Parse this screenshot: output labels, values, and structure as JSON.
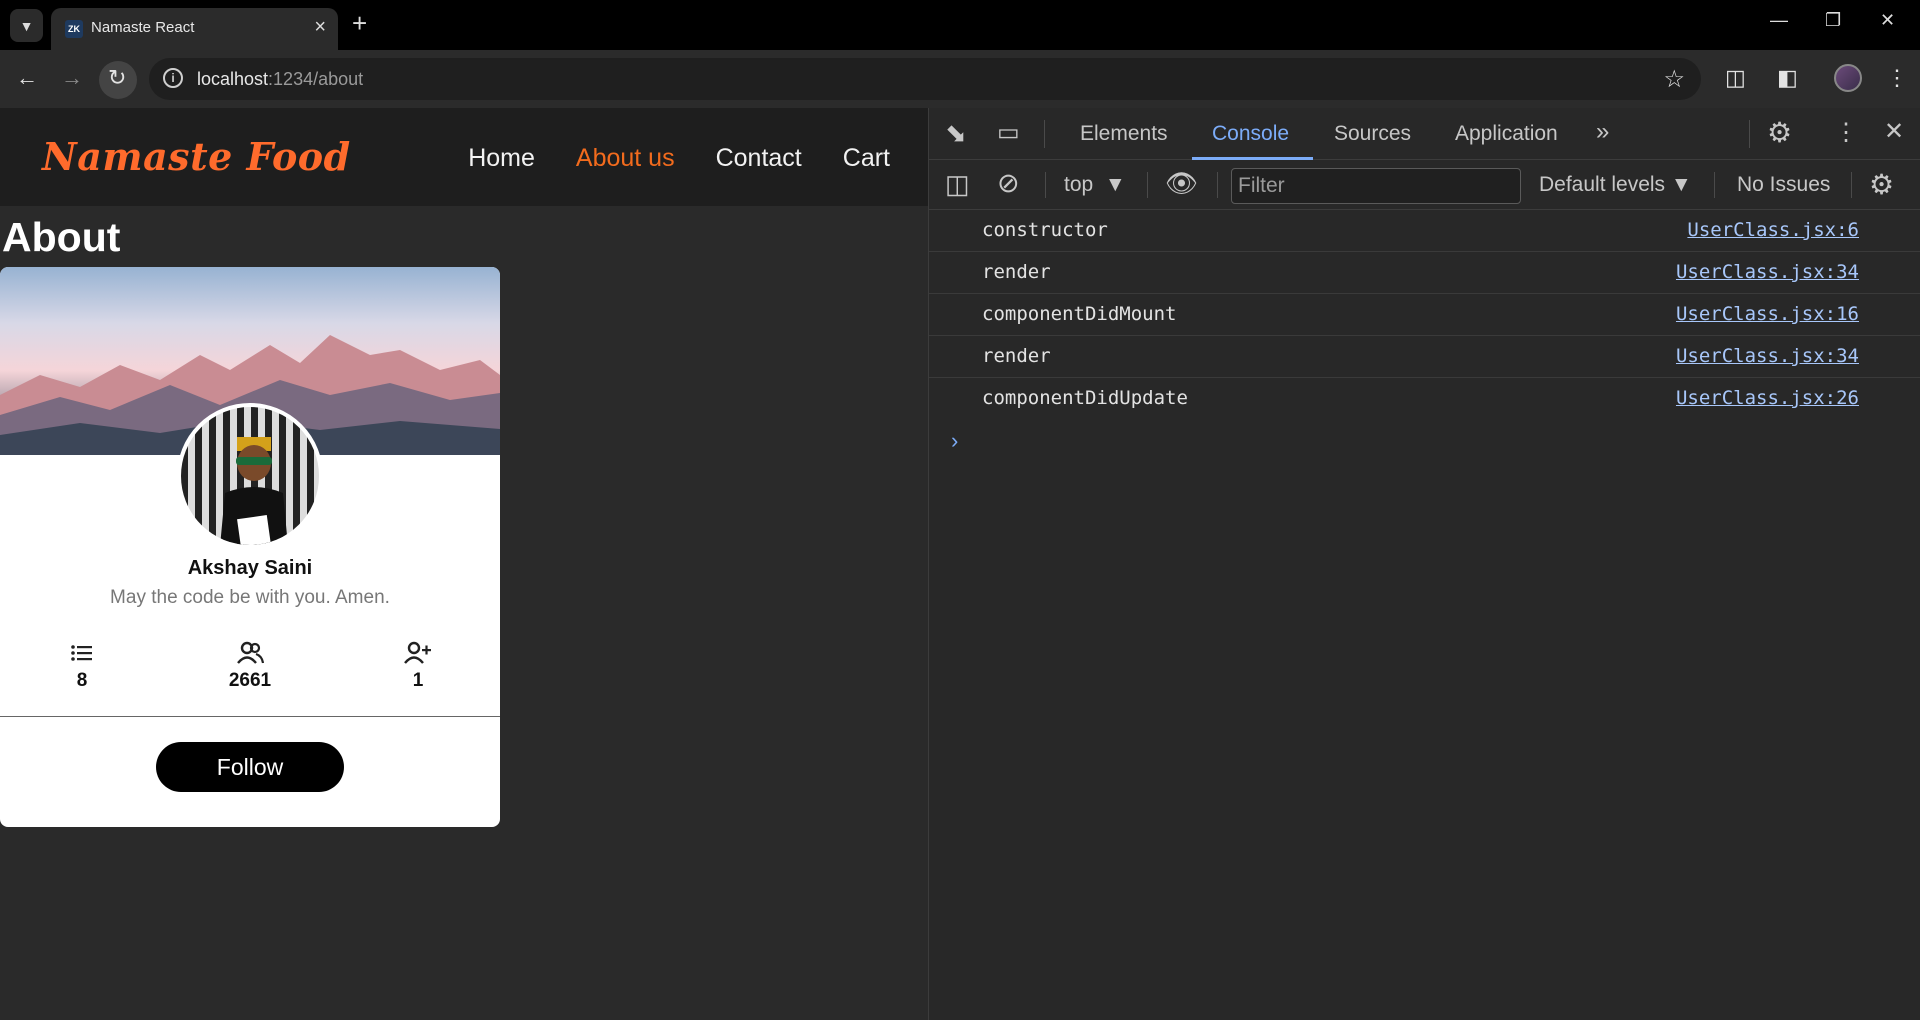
{
  "browser": {
    "tab_title": "Namaste React",
    "favicon_text": "ZK",
    "url_host": "localhost",
    "url_path": ":1234/about",
    "icons": [
      "tab-search-icon",
      "close-icon",
      "plus-icon",
      "minimize-icon",
      "restore-icon",
      "back-icon",
      "forward-icon",
      "reload-icon",
      "info-icon",
      "star-icon",
      "extensions-icon",
      "side-panel-icon",
      "menu-icon"
    ]
  },
  "site": {
    "logo": "Namaste Food",
    "nav": [
      {
        "label": "Home"
      },
      {
        "label": "About us",
        "active": true
      },
      {
        "label": "Contact"
      },
      {
        "label": "Cart"
      }
    ],
    "heading": "About",
    "card": {
      "name": "Akshay Saini",
      "bio": "May the code be with you. Amen.",
      "stats": [
        {
          "icon": "list-icon",
          "value": "8"
        },
        {
          "icon": "group-icon",
          "value": "2661"
        },
        {
          "icon": "add-person-icon",
          "value": "1"
        }
      ],
      "follow_label": "Follow"
    },
    "accent_color": "#f26b1d"
  },
  "devtools": {
    "tabs": [
      {
        "label": "Elements"
      },
      {
        "label": "Console",
        "active": true
      },
      {
        "label": "Sources"
      },
      {
        "label": "Application"
      }
    ],
    "context": "top",
    "filter_placeholder": "Filter",
    "levels": "Default levels",
    "issues": "No Issues",
    "logs": [
      {
        "message": "constructor",
        "source": "UserClass.jsx:6"
      },
      {
        "message": "render",
        "source": "UserClass.jsx:34"
      },
      {
        "message": "componentDidMount",
        "source": "UserClass.jsx:16"
      },
      {
        "message": "render",
        "source": "UserClass.jsx:34"
      },
      {
        "message": "componentDidUpdate",
        "source": "UserClass.jsx:26"
      }
    ],
    "link_color": "#a8c7fa"
  }
}
